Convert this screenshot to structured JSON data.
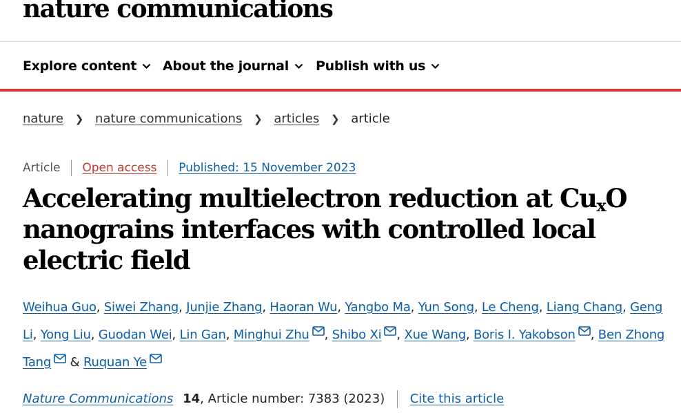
{
  "site": {
    "logo_text": "nature communications"
  },
  "nav": {
    "items": [
      {
        "label": "Explore content"
      },
      {
        "label": "About the journal"
      },
      {
        "label": "Publish with us"
      }
    ]
  },
  "breadcrumb": {
    "items": [
      "nature",
      "nature communications",
      "articles"
    ],
    "current": "article"
  },
  "meta": {
    "type": "Article",
    "access": "Open access",
    "published": "Published: 15 November 2023"
  },
  "article": {
    "title_part1": "Accelerating multielectron reduction at Cu",
    "title_sub": "x",
    "title_part2": "O nanograins interfaces with controlled local electric field"
  },
  "authors": [
    {
      "name": "Weihua Guo",
      "email": false
    },
    {
      "name": "Siwei Zhang",
      "email": false
    },
    {
      "name": "Junjie Zhang",
      "email": false
    },
    {
      "name": "Haoran Wu",
      "email": false
    },
    {
      "name": "Yangbo Ma",
      "email": false
    },
    {
      "name": "Yun Song",
      "email": false
    },
    {
      "name": "Le Cheng",
      "email": false
    },
    {
      "name": "Liang Chang",
      "email": false
    },
    {
      "name": "Geng Li",
      "email": false
    },
    {
      "name": "Yong Liu",
      "email": false
    },
    {
      "name": "Guodan Wei",
      "email": false
    },
    {
      "name": "Lin Gan",
      "email": false
    },
    {
      "name": "Minghui Zhu",
      "email": true
    },
    {
      "name": "Shibo Xi",
      "email": true
    },
    {
      "name": "Xue Wang",
      "email": false
    },
    {
      "name": "Boris I. Yakobson",
      "email": true
    },
    {
      "name": "Ben Zhong Tang",
      "email": true
    },
    {
      "name": "Ruquan Ye",
      "email": true
    }
  ],
  "citation": {
    "journal": "Nature Communications",
    "volume": "14",
    "article_number": ", Article number: 7383 (2023)",
    "cite_label": "Cite this article"
  },
  "colors": {
    "accent_red": "#e0332a",
    "link_blue": "#0b5da8",
    "open_access_red": "#c0392b"
  },
  "icons": {
    "nav_chevron": "chevron-down-icon",
    "breadcrumb_separator": "chevron-right-icon",
    "author_email": "envelope-icon"
  }
}
